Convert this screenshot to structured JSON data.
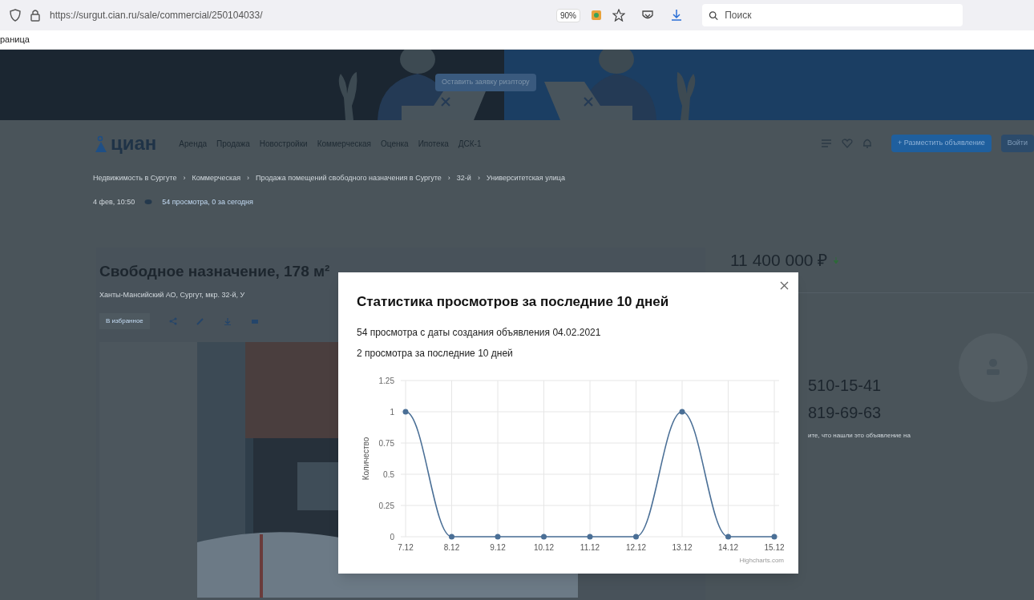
{
  "browser": {
    "url": "https://surgut.cian.ru/sale/commercial/250104033/",
    "zoom": "90%",
    "search_placeholder": "Поиск",
    "bookmark": "раница"
  },
  "banner": {
    "button": "Оставить заявку риэлтору"
  },
  "header": {
    "logo": "циан",
    "nav": [
      "Аренда",
      "Продажа",
      "Новостройки",
      "Коммерческая",
      "Оценка",
      "Ипотека",
      "ДСК-1"
    ],
    "post_button": "+ Разместить объявление",
    "login": "Войти"
  },
  "breadcrumb_separator": "›",
  "breadcrumbs": [
    "Недвижимость в Сургуте",
    "Коммерческая",
    "Продажа помещений свободного назначения в Сургуте",
    "32-й",
    "Университетская улица"
  ],
  "meta": {
    "date": "4 фев, 10:50",
    "views": "54 просмотра, 0 за сегодня"
  },
  "listing": {
    "title": "Свободное назначение, 178 м²",
    "address": "Ханты-Мансийский АО, Сургут, мкр. 32-й, У",
    "favorite": "В избранное",
    "price": "11 400 000 ₽",
    "phones": [
      "510-15-41",
      "819-69-63"
    ],
    "note": "ите, что нашли это объявление на"
  },
  "modal": {
    "title": "Статистика просмотров за последние 10 дней",
    "lines": [
      "54 просмотра с даты создания объявления 04.02.2021",
      "2 просмотра за последние 10 дней"
    ],
    "chart_data": {
      "type": "line",
      "ylabel": "Количество",
      "categories": [
        "7.12",
        "8.12",
        "9.12",
        "10.12",
        "11.12",
        "12.12",
        "13.12",
        "14.12",
        "15.12"
      ],
      "series": [
        {
          "color": "#4a6f96",
          "marker": true,
          "values": [
            1,
            0,
            0,
            0,
            0,
            0,
            1,
            0,
            0
          ]
        }
      ],
      "ylim": [
        0,
        1.25
      ],
      "yticks": [
        0,
        0.25,
        0.5,
        0.75,
        1,
        1.25
      ],
      "grid": true
    },
    "credit": "Highcharts.com"
  }
}
